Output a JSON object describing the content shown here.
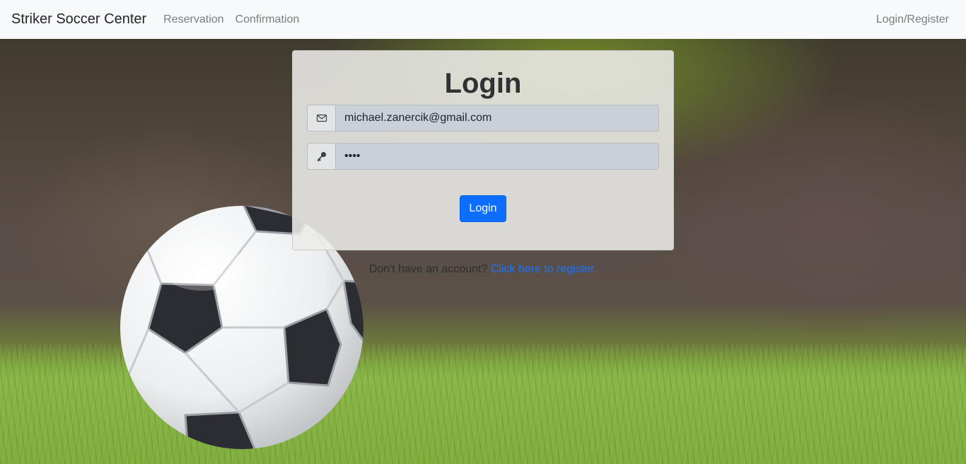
{
  "navbar": {
    "brand": "Striker Soccer Center",
    "links": [
      "Reservation",
      "Confirmation"
    ],
    "right_link": "Login/Register"
  },
  "login_card": {
    "title": "Login",
    "email": {
      "value": "michael.zanercik@gmail.com",
      "icon": "envelope-icon"
    },
    "password": {
      "value": "••••",
      "icon": "key-icon"
    },
    "submit_label": "Login"
  },
  "register": {
    "prompt": "Don't have an account?",
    "link": "Click here to register."
  },
  "colors": {
    "navbar_bg": "#f8f9fa",
    "primary": "#0d6efd",
    "link": "#1a73ff",
    "grass": "#86b040"
  }
}
